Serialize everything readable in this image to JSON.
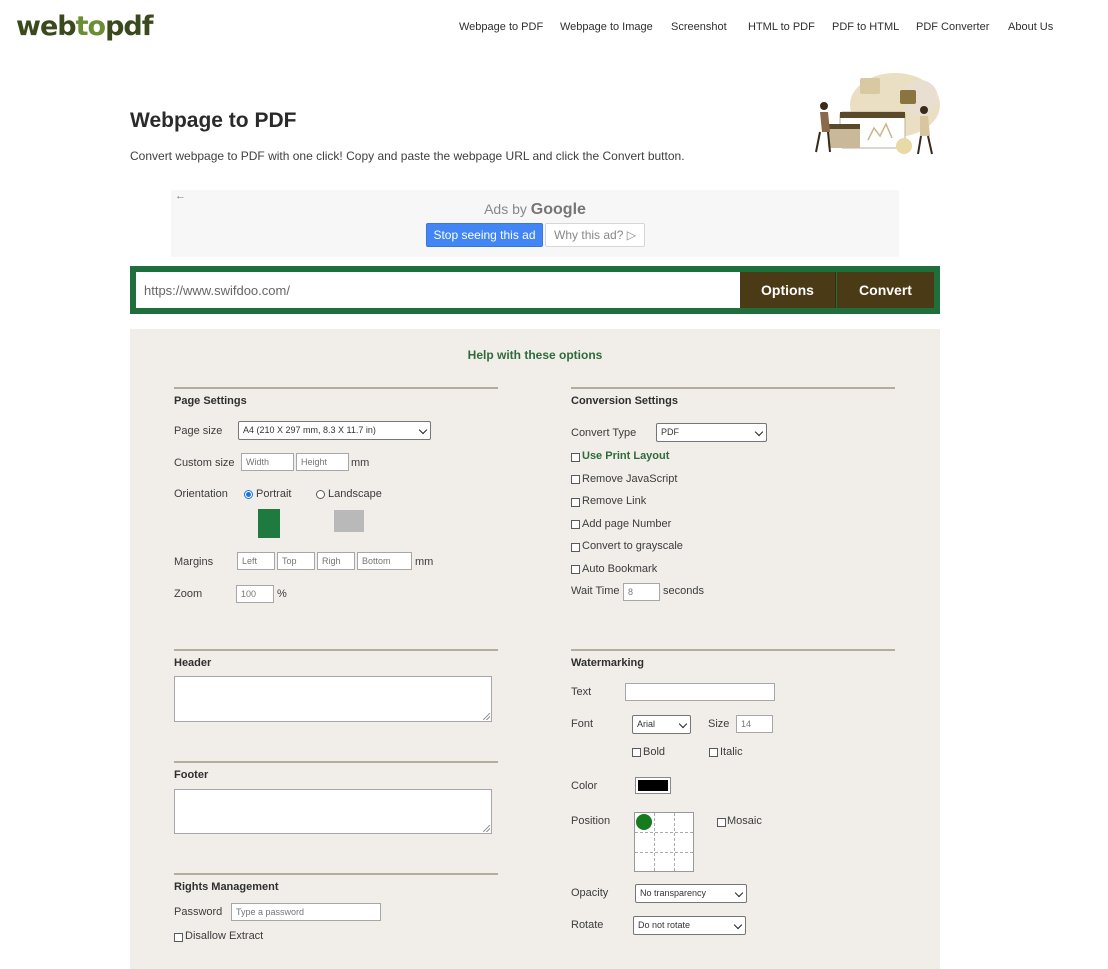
{
  "brand": {
    "logo_part1": "web",
    "logo_part2": "to",
    "logo_part3": "pdf"
  },
  "nav": {
    "items": [
      "Webpage to PDF",
      "Webpage to Image",
      "Screenshot",
      "HTML to PDF",
      "PDF to HTML",
      "PDF Converter",
      "About Us"
    ]
  },
  "hero": {
    "title": "Webpage to PDF",
    "description": "Convert webpage to PDF with one click! Copy and paste the webpage URL and click the Convert button."
  },
  "ad": {
    "back_arrow": "←",
    "ads_by": "Ads by",
    "google": "Google",
    "stop_label": "Stop seeing this ad",
    "why_label": "Why this ad? ▷"
  },
  "url_bar": {
    "value": "https://www.swifdoo.com/",
    "options_label": "Options",
    "convert_label": "Convert"
  },
  "panel": {
    "help_link": "Help with these options",
    "page_settings": {
      "title": "Page Settings",
      "page_size_label": "Page size",
      "page_size_value": "A4 (210 X 297 mm, 8.3 X 11.7 in)",
      "custom_size_label": "Custom size",
      "width_placeholder": "Width",
      "height_placeholder": "Height",
      "unit_mm": "mm",
      "orientation_label": "Orientation",
      "portrait_label": "Portrait",
      "landscape_label": "Landscape",
      "margins_label": "Margins",
      "margin_left": "Left",
      "margin_top": "Top",
      "margin_right": "Righ",
      "margin_bottom": "Bottom",
      "margins_unit": "mm",
      "zoom_label": "Zoom",
      "zoom_value": "100",
      "zoom_unit": "%"
    },
    "conversion_settings": {
      "title": "Conversion Settings",
      "convert_type_label": "Convert Type",
      "convert_type_value": "PDF",
      "use_print_layout": "Use Print Layout",
      "remove_js": "Remove JavaScript",
      "remove_link": "Remove Link",
      "add_page_number": "Add page Number",
      "grayscale": "Convert to grayscale",
      "auto_bookmark": "Auto Bookmark",
      "wait_time_label": "Wait Time",
      "wait_time_value": "8",
      "wait_time_unit": "seconds"
    },
    "header": {
      "title": "Header"
    },
    "footer": {
      "title": "Footer"
    },
    "rights": {
      "title": "Rights Management",
      "password_label": "Password",
      "password_placeholder": "Type a password",
      "disallow_extract": "Disallow Extract"
    },
    "watermarking": {
      "title": "Watermarking",
      "text_label": "Text",
      "font_label": "Font",
      "font_value": "Arial",
      "size_label": "Size",
      "size_value": "14",
      "bold_label": "Bold",
      "italic_label": "Italic",
      "color_label": "Color",
      "color_value": "#000000",
      "position_label": "Position",
      "mosaic_label": "Mosaic",
      "opacity_label": "Opacity",
      "opacity_value": "No transparency",
      "rotate_label": "Rotate",
      "rotate_value": "Do not rotate"
    }
  }
}
